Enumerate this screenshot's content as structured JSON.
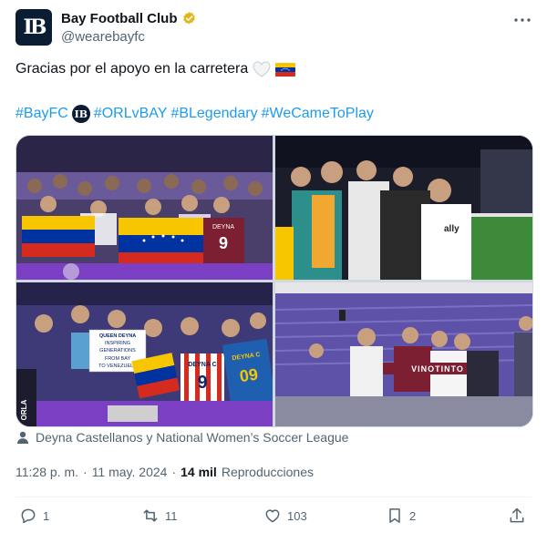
{
  "author": {
    "avatar_text": "IB",
    "name": "Bay Football Club",
    "handle": "@wearebayfc"
  },
  "tweet": {
    "text": "Gracias por el apoyo en la carretera",
    "emoji_heart": "🤍",
    "emoji_flag": "🇻🇪",
    "hashtags": [
      "#BayFC",
      "#ORLvBAY",
      "#BLegendary",
      "#WeCameToPlay"
    ],
    "badge_text": "IB"
  },
  "media": {
    "photos": [
      {
        "desc": "fans-with-venezuela-flags",
        "jersey_text": "DEYNA",
        "jersey_number": "9"
      },
      {
        "desc": "player-hugging-fans",
        "shirt_text": "ally"
      },
      {
        "desc": "fans-with-signs",
        "sign_text": [
          "QUEEN DEYNA",
          "INSPIRING",
          "GENERATIONS",
          "FROM BAY",
          "TO VENEZUELA"
        ],
        "jersey1": "DEYNA C",
        "jersey1_num": "9",
        "jersey2": "DEYNA C",
        "jersey2_num": "09",
        "side_text": "ORLA"
      },
      {
        "desc": "player-selfie-with-fans",
        "scarf_text": "VINOTINTO"
      }
    ]
  },
  "tagged": "Deyna Castellanos y National Women’s Soccer League",
  "meta": {
    "time": "11:28 p. m.",
    "sep": "·",
    "date": "11 may. 2024",
    "sep2": "·",
    "views_count": "14 mil",
    "views_label": "Reproducciones"
  },
  "actions": {
    "replies": "1",
    "reposts": "11",
    "likes": "103",
    "bookmarks": "2"
  },
  "colors": {
    "link": "#1d9bf0",
    "muted": "#536471",
    "text": "#0f1419",
    "verified": "#e2b719"
  }
}
